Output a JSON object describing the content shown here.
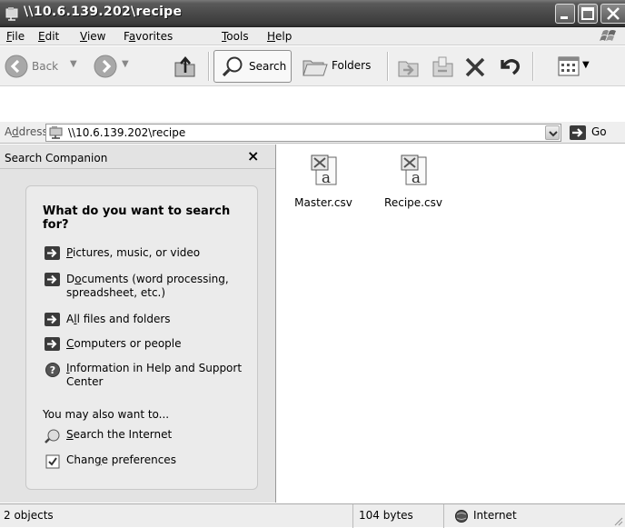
{
  "window": {
    "title": "\\\\10.6.139.202\\recipe"
  },
  "menu": {
    "items": [
      {
        "label": "File",
        "key": "F",
        "rest": "ile"
      },
      {
        "label": "Edit",
        "key": "E",
        "rest": "dit"
      },
      {
        "label": "View",
        "key": "V",
        "rest": "iew"
      },
      {
        "label": "Favorites",
        "key": "a",
        "pre": "F",
        "rest": "vorites"
      },
      {
        "label": "Tools",
        "key": "T",
        "rest": "ools"
      },
      {
        "label": "Help",
        "key": "H",
        "rest": "elp"
      }
    ]
  },
  "toolbar": {
    "back_label": "Back",
    "search_label": "Search",
    "folders_label": "Folders"
  },
  "address": {
    "label_pre": "A",
    "label_key": "d",
    "label_rest": "dress",
    "value": "\\\\10.6.139.202\\recipe",
    "go_label": "Go"
  },
  "search_companion": {
    "title": "Search Companion",
    "close_glyph": "×",
    "question": "What do you want to search for?",
    "options": [
      {
        "pre": "",
        "key": "P",
        "rest": "ictures, music, or video"
      },
      {
        "pre": "D",
        "key": "o",
        "rest": "cuments (word processing, spreadsheet, etc.)"
      },
      {
        "pre": "A",
        "key": "l",
        "rest": "l files and folders"
      },
      {
        "pre": "",
        "key": "C",
        "rest": "omputers or people"
      },
      {
        "pre": "",
        "key": "I",
        "rest": "nformation in Help and Support Center"
      }
    ],
    "also_label": "You may also want to...",
    "also_options": [
      {
        "pre": "",
        "key": "S",
        "rest": "earch the Internet"
      },
      {
        "pre": "Chan",
        "key": "g",
        "rest": "e preferences"
      }
    ]
  },
  "files": [
    {
      "name": "Master.csv",
      "icon": "csv-file-icon"
    },
    {
      "name": "Recipe.csv",
      "icon": "csv-file-icon"
    }
  ],
  "status": {
    "objects": "2 objects",
    "size": "104 bytes",
    "zone": "Internet"
  }
}
